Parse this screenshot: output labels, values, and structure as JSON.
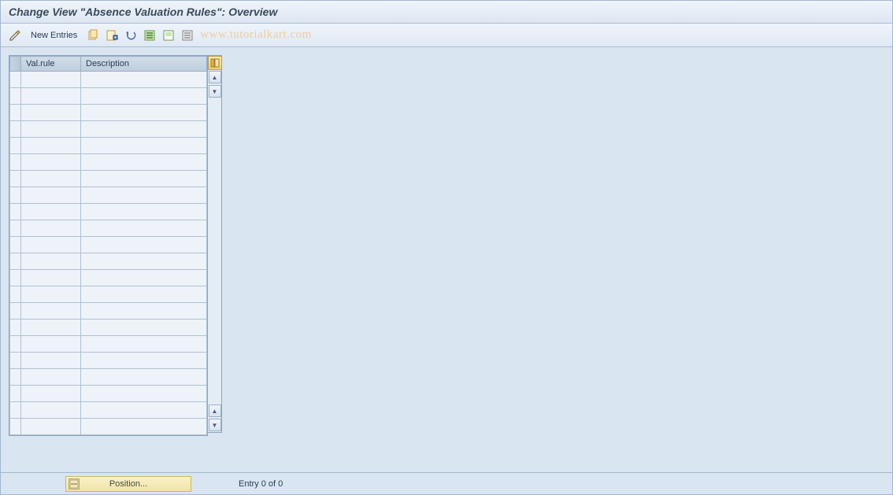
{
  "title": "Change View \"Absence Valuation Rules\": Overview",
  "toolbar": {
    "new_entries_label": "New Entries"
  },
  "watermark": "www.tutorialkart.com",
  "table": {
    "headers": {
      "val_rule": "Val.rule",
      "description": "Description"
    },
    "row_count": 22
  },
  "footer": {
    "position_label": "Position...",
    "entry_text": "Entry 0 of 0"
  }
}
